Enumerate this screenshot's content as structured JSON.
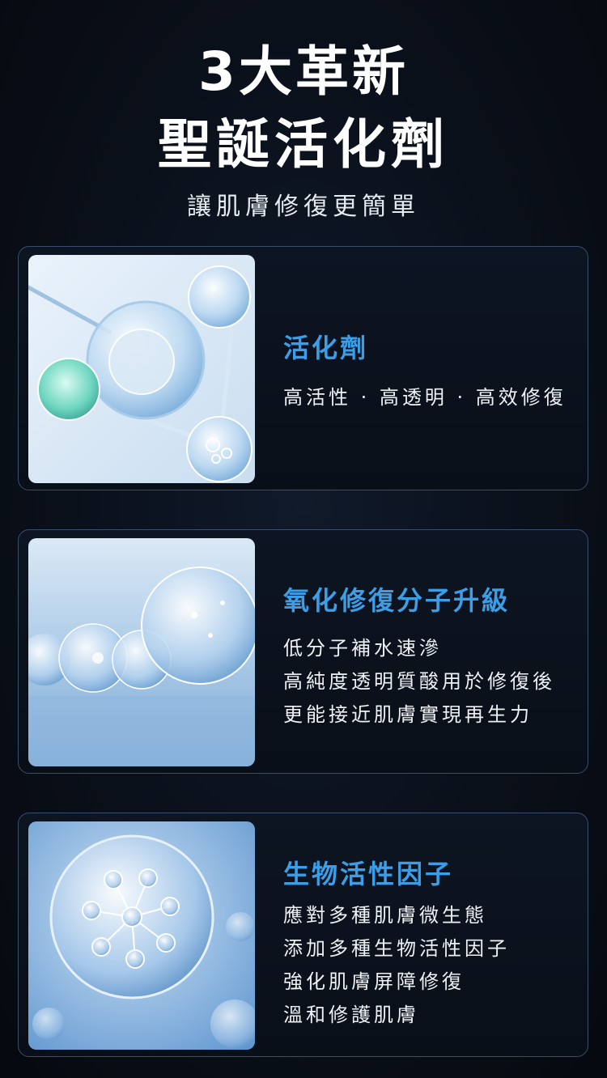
{
  "header": {
    "title_line1": "3大革新",
    "title_line2": "聖誕活化劑",
    "subtitle": "讓肌膚修復更簡單"
  },
  "cards": [
    {
      "heading": "活化劑",
      "lines": [
        "高活性 · 高透明 · 高效修復"
      ],
      "image": "serum-droplet-spheres-image"
    },
    {
      "heading": "氧化修復分子升級",
      "lines": [
        "低分子補水速滲",
        "高純度透明質酸用於修復後",
        "更能接近肌膚實現再生力"
      ],
      "image": "hydrating-bubbles-image"
    },
    {
      "heading": "生物活性因子",
      "lines": [
        "應對多種肌膚微生態",
        "添加多種生物活性因子",
        "強化肌膚屏障修復",
        "溫和修護肌膚"
      ],
      "image": "molecule-bubble-image"
    }
  ],
  "colors": {
    "background": "#0a101a",
    "accent_heading": "#3d9ee8",
    "card_border": "#3a4d6a",
    "text": "#ffffff"
  }
}
